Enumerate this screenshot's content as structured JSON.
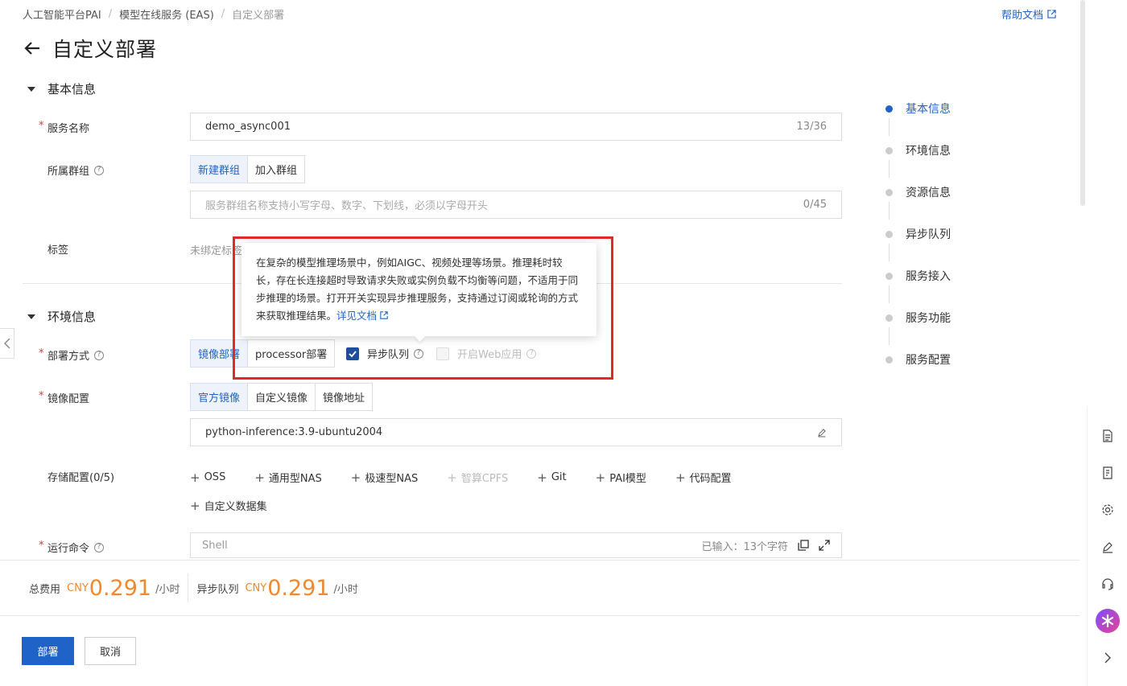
{
  "breadcrumb": {
    "items": [
      "人工智能平台PAI",
      "模型在线服务 (EAS)"
    ],
    "current": "自定义部署"
  },
  "help_link": "帮助文档",
  "page_title": "自定义部署",
  "sections": {
    "basic": "基本信息",
    "env": "环境信息"
  },
  "fields": {
    "service_name": {
      "label": "服务名称",
      "value": "demo_async001",
      "count": "13/36"
    },
    "group": {
      "label": "所属群组",
      "options": [
        "新建群组",
        "加入群组"
      ],
      "placeholder": "服务群组名称支持小写字母、数字、下划线，必须以字母开头",
      "count": "0/45"
    },
    "tag": {
      "label": "标签",
      "empty": "未绑定标签"
    },
    "deploy_mode": {
      "label": "部署方式",
      "options": [
        "镜像部署",
        "processor部署"
      ],
      "async_queue": "异步队列",
      "web_app": "开启Web应用"
    },
    "image_config": {
      "label": "镜像配置",
      "options": [
        "官方镜像",
        "自定义镜像",
        "镜像地址"
      ],
      "value": "python-inference:3.9-ubuntu2004"
    },
    "storage": {
      "label": "存储配置(0/5)",
      "items": [
        "OSS",
        "通用型NAS",
        "极速型NAS",
        "智算CPFS",
        "Git",
        "PAI模型",
        "代码配置"
      ],
      "extra": "自定义数据集"
    },
    "command": {
      "label": "运行命令",
      "placeholder": "Shell",
      "count": "已输入：13个字符"
    }
  },
  "tooltip": {
    "text": "在复杂的模型推理场景中，例如AIGC、视频处理等场景。推理耗时较长，存在长连接超时导致请求失败或实例负载不均衡等问题，不适用于同步推理的场景。打开开关实现异步推理服务，支持通过订阅或轮询的方式来获取推理结果。",
    "link": "详见文档"
  },
  "steps": [
    "基本信息",
    "环境信息",
    "资源信息",
    "异步队列",
    "服务接入",
    "服务功能",
    "服务配置"
  ],
  "cost": {
    "total_label": "总费用",
    "total_currency": "CNY",
    "total_value": "0.291",
    "total_unit": "/小时",
    "async_label": "异步队列",
    "async_currency": "CNY",
    "async_value": "0.291",
    "async_unit": "/小时"
  },
  "actions": {
    "deploy": "部署",
    "cancel": "取消"
  },
  "colors": {
    "primary": "#1f63c9",
    "price": "#f0882e",
    "highlight": "#e02a26"
  }
}
